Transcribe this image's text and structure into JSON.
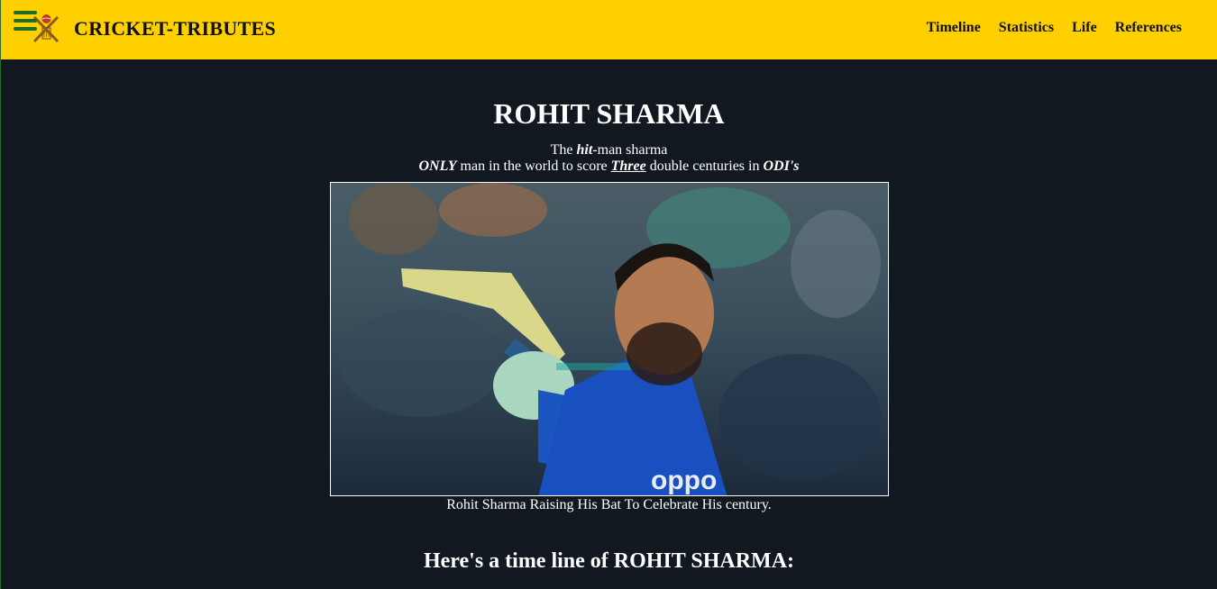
{
  "navbar": {
    "brand": "CRICKET-TRIBUTES",
    "links": [
      "Timeline",
      "Statistics",
      "Life",
      "References"
    ],
    "background_color": "#ffd000",
    "menu_icon": "hamburger-menu-icon",
    "logo_icon": "crossed-bats-ball-logo-icon"
  },
  "main": {
    "title": "ROHIT SHARMA",
    "subtitle_line1": {
      "pre": "The ",
      "bold_italic": "hit",
      "post": "-man sharma"
    },
    "subtitle_line2": {
      "bold1": "ONLY",
      "text1": " man in the world to score ",
      "underline": "Three",
      "text2": " double centuries in ",
      "bold2": "ODI's"
    },
    "image_caption": "Rohit Sharma Raising His Bat To Celebrate His century.",
    "timeline_heading": "Here's a time line of ROHIT SHARMA:"
  },
  "colors": {
    "page_background": "#11181f",
    "text": "#ffffff"
  }
}
